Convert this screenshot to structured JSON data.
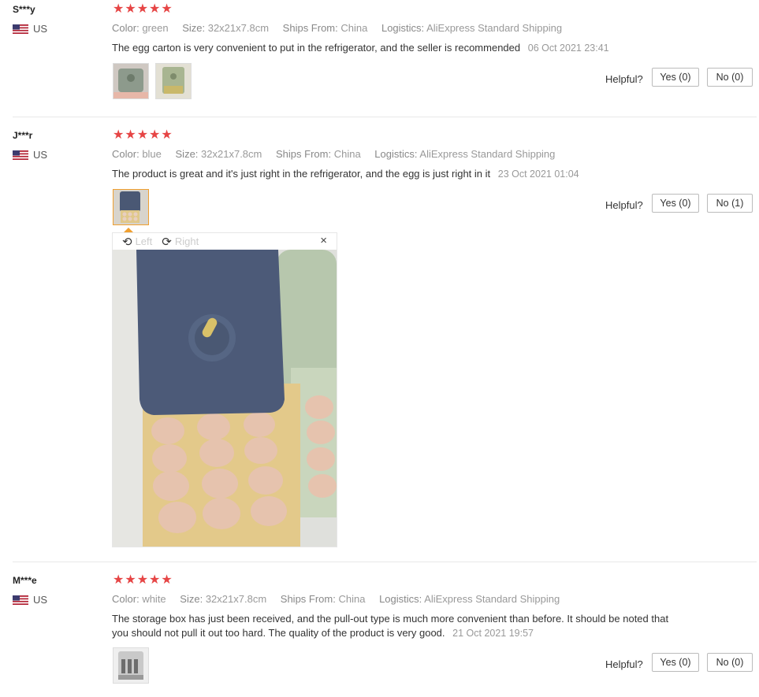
{
  "reviews": [
    {
      "user": "S***y",
      "country": "US",
      "stars": "★★★★★",
      "color_label": "Color:",
      "color": "green",
      "size_label": "Size:",
      "size": "32x21x7.8cm",
      "ships_label": "Ships From:",
      "ships": "China",
      "logistics_label": "Logistics:",
      "logistics": "AliExpress Standard Shipping",
      "text": "The egg carton is very convenient to put in the refrigerator, and the seller is recommended",
      "date": "06 Oct 2021 23:41",
      "helpful_label": "Helpful?",
      "yes_label": "Yes (0)",
      "no_label": "No (0)"
    },
    {
      "user": "J***r",
      "country": "US",
      "stars": "★★★★★",
      "color_label": "Color:",
      "color": "blue",
      "size_label": "Size:",
      "size": "32x21x7.8cm",
      "ships_label": "Ships From:",
      "ships": "China",
      "logistics_label": "Logistics:",
      "logistics": "AliExpress Standard Shipping",
      "text": "The product is great and it's just right in the refrigerator, and the egg is just right in it",
      "date": "23 Oct 2021 01:04",
      "helpful_label": "Helpful?",
      "yes_label": "Yes (0)",
      "no_label": "No (1)",
      "viewer": {
        "left_label": "Left",
        "right_label": "Right",
        "close": "×"
      }
    },
    {
      "user": "M***e",
      "country": "US",
      "stars": "★★★★★",
      "color_label": "Color:",
      "color": "white",
      "size_label": "Size:",
      "size": "32x21x7.8cm",
      "ships_label": "Ships From:",
      "ships": "China",
      "logistics_label": "Logistics:",
      "logistics": "AliExpress Standard Shipping",
      "text": "The storage box has just been received, and the pull-out type is much more convenient than before. It should be noted that you should not pull it out too hard. The quality of the product is very good.",
      "date": "21 Oct 2021 19:57",
      "helpful_label": "Helpful?",
      "yes_label": "Yes (0)",
      "no_label": "No (0)"
    }
  ],
  "colors": {
    "star": "#e64545",
    "active_thumb_border": "#f0a030"
  }
}
